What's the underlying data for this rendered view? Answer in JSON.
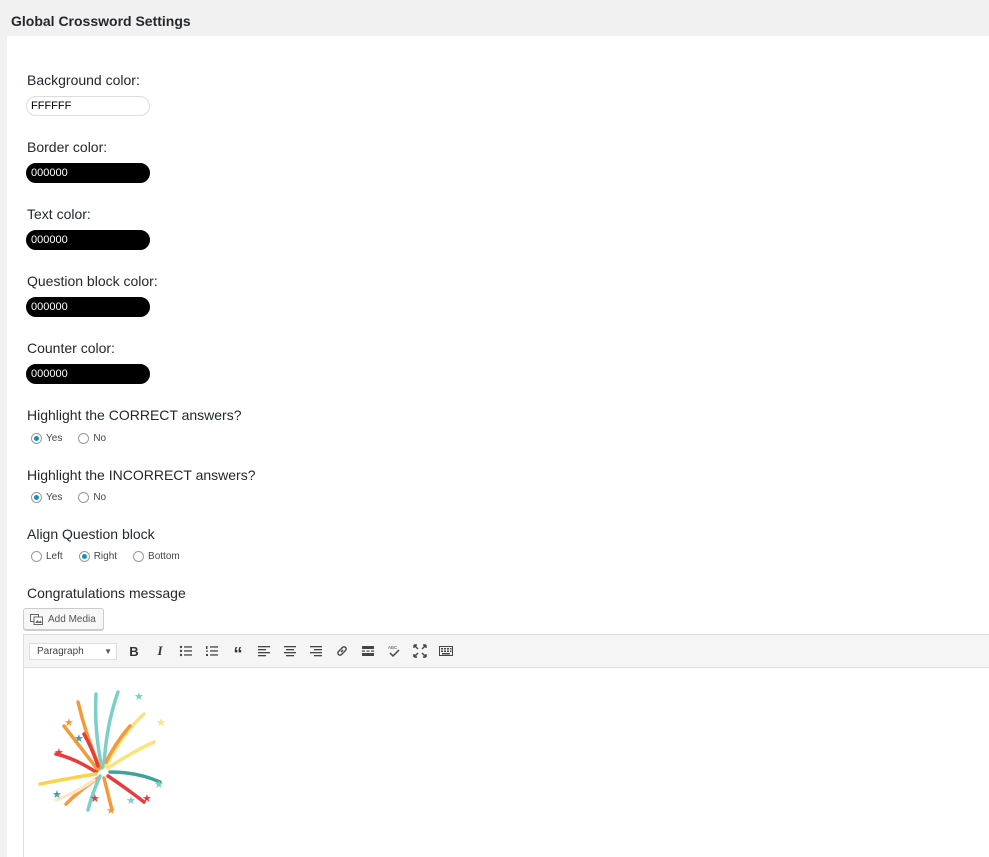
{
  "page": {
    "title": "Global Crossword Settings"
  },
  "colors": {
    "background": {
      "label": "Background color:",
      "value": "FFFFFF",
      "swatch": "#FFFFFF"
    },
    "border": {
      "label": "Border color:",
      "value": "000000",
      "swatch": "#000000"
    },
    "text": {
      "label": "Text color:",
      "value": "000000",
      "swatch": "#000000"
    },
    "question_block": {
      "label": "Question block color:",
      "value": "000000",
      "swatch": "#000000"
    },
    "counter": {
      "label": "Counter color:",
      "value": "000000",
      "swatch": "#000000"
    }
  },
  "highlight_correct": {
    "label": "Highlight the CORRECT answers?",
    "options": [
      "Yes",
      "No"
    ],
    "selected": "Yes"
  },
  "highlight_incorrect": {
    "label": "Highlight the INCORRECT answers?",
    "options": [
      "Yes",
      "No"
    ],
    "selected": "Yes"
  },
  "align_question_block": {
    "label": "Align Question block",
    "options": [
      "Left",
      "Right",
      "Bottom"
    ],
    "selected": "Right"
  },
  "congratulations": {
    "label": "Congratulations message",
    "add_media_label": "Add Media",
    "format_select": "Paragraph",
    "toolbar_icons": [
      "bold-icon",
      "italic-icon",
      "bullet-list-icon",
      "numbered-list-icon",
      "blockquote-icon",
      "align-left-icon",
      "align-center-icon",
      "align-right-icon",
      "link-icon",
      "read-more-icon",
      "spellcheck-icon",
      "fullscreen-icon",
      "toolbar-toggle-icon"
    ],
    "content_image": "firework-image"
  },
  "accent_color": "#1e8cbe"
}
